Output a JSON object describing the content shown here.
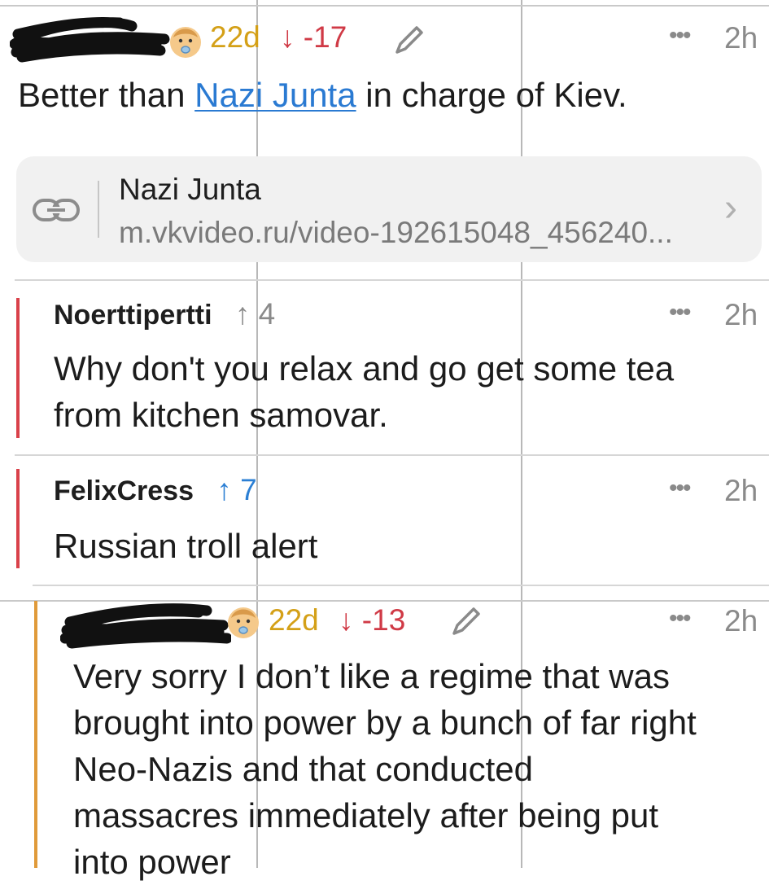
{
  "comments": [
    {
      "author_redacted": true,
      "age_badge": "22d",
      "score": "-17",
      "time": "2h",
      "text_before_link": "Better than ",
      "link_text": "Nazi Junta",
      "text_after_link": " in charge of Kiev.",
      "link_preview": {
        "title": "Nazi Junta",
        "url": "m.vkvideo.ru/video-192615048_456240..."
      }
    },
    {
      "author": "Noerttipertti",
      "score": "4",
      "time": "2h",
      "text_line1": "Why don't you relax and go get some tea",
      "text_line2": "from kitchen samovar.",
      "thread_color": "#d9414a"
    },
    {
      "author": "FelixCress",
      "score": "7",
      "time": "2h",
      "text": "Russian troll alert",
      "thread_color": "#d9414a"
    },
    {
      "author_redacted": true,
      "age_badge": "22d",
      "score": "-13",
      "time": "2h",
      "text_lines": [
        "Very sorry I don’t like a regime that was",
        "brought into power by a bunch of far right",
        "Neo-Nazis and that conducted",
        "massacres immediately after being put",
        "into power"
      ],
      "thread_color": "#e09a3a"
    }
  ],
  "icons": {
    "arrow_down": "↓",
    "arrow_up": "↑",
    "more": "•••",
    "chevron": "›",
    "link": "link-icon",
    "pencil": "pencil-icon",
    "baby": "baby-icon"
  },
  "colors": {
    "age_badge": "#d4a017",
    "downvote": "#d03a46",
    "upvote_blue": "#2b7fd4",
    "link": "#2a7ad2"
  }
}
